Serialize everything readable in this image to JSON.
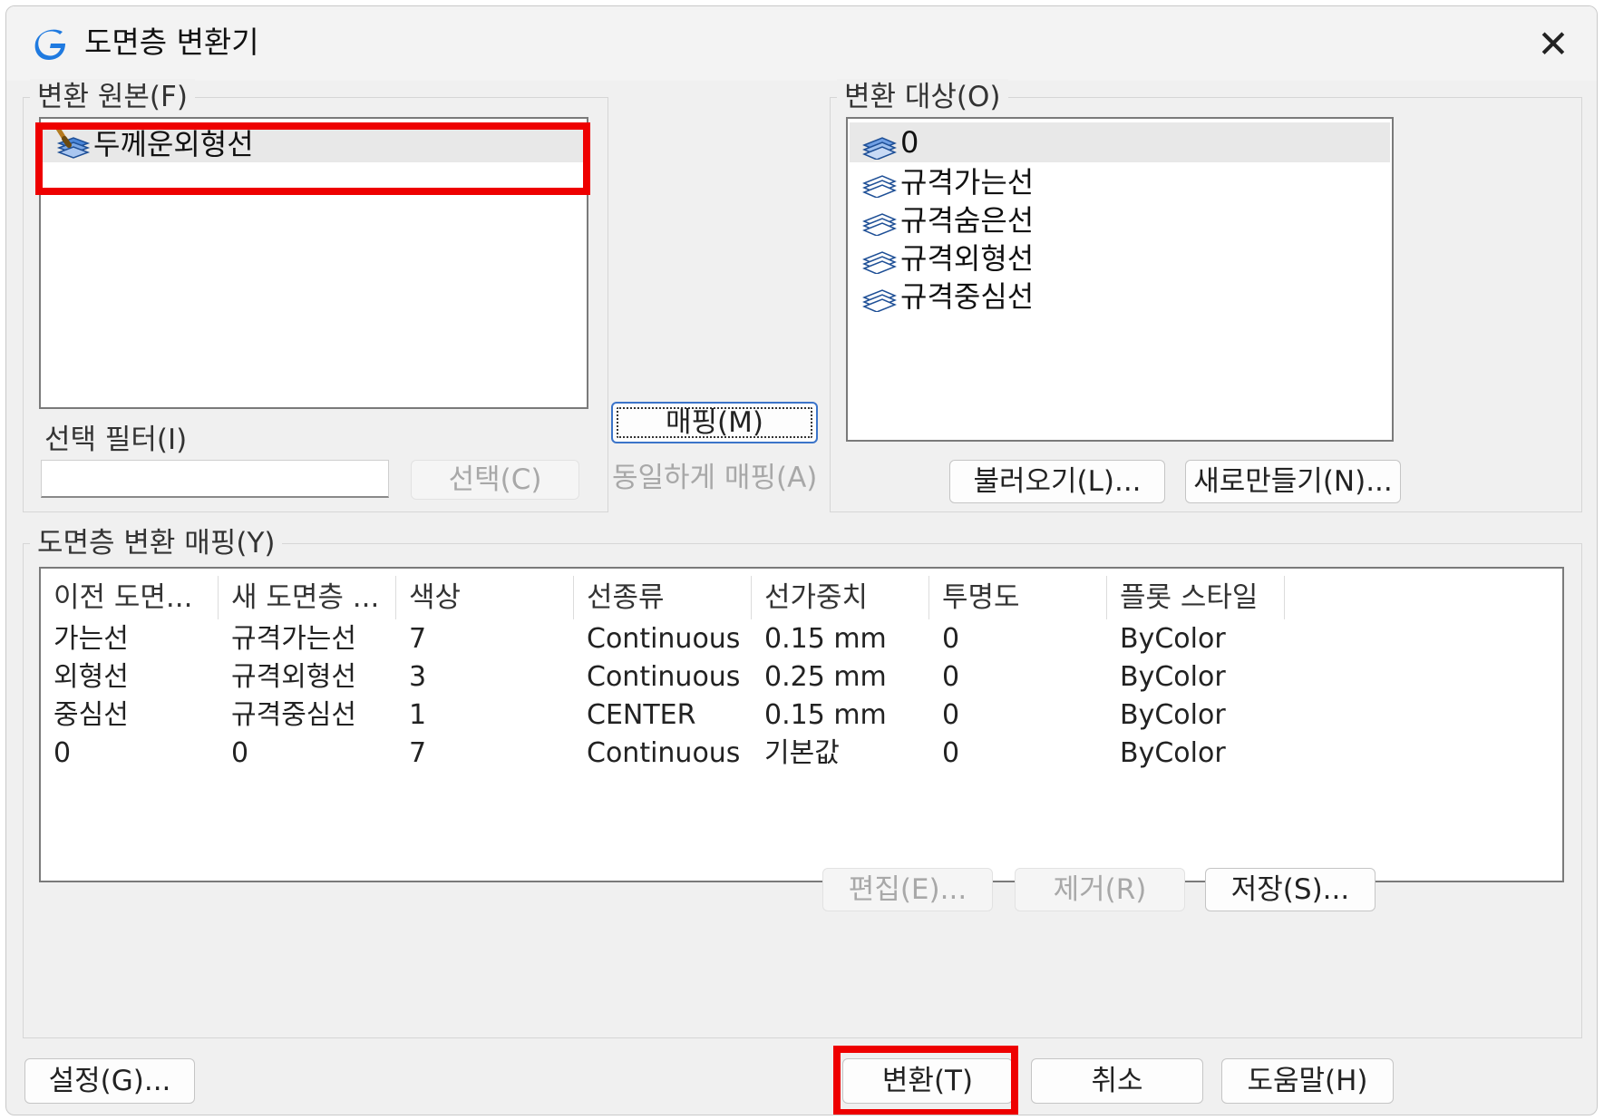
{
  "window": {
    "title": "도면층 변환기",
    "close_label": "✕"
  },
  "source": {
    "group_label": "변환 원본(F)",
    "items": [
      {
        "label": "두께운외형선"
      }
    ],
    "filter_label": "선택 필터(I)",
    "filter_value": "",
    "select_button": "선택(C)"
  },
  "middle": {
    "map_button": "매핑(M)",
    "map_same_button": "동일하게 매핑(A)"
  },
  "target": {
    "group_label": "변환 대상(O)",
    "items": [
      {
        "label": "0"
      },
      {
        "label": "규격가는선"
      },
      {
        "label": "규격숨은선"
      },
      {
        "label": "규격외형선"
      },
      {
        "label": "규격중심선"
      }
    ],
    "load_button": "불러오기(L)...",
    "new_button": "새로만들기(N)..."
  },
  "mapping": {
    "group_label": "도면층 변환 매핑(Y)",
    "columns": [
      "이전 도면...",
      "새 도면층 ...",
      "색상",
      "선종류",
      "선가중치",
      "투명도",
      "플롯 스타일"
    ],
    "rows": [
      [
        "가는선",
        "규격가는선",
        "7",
        "Continuous",
        "0.15 mm",
        "0",
        "ByColor"
      ],
      [
        "외형선",
        "규격외형선",
        "3",
        "Continuous",
        "0.25 mm",
        "0",
        "ByColor"
      ],
      [
        "중심선",
        "규격중심선",
        "1",
        "CENTER",
        "0.15 mm",
        "0",
        "ByColor"
      ],
      [
        "0",
        "0",
        "7",
        "Continuous",
        "기본값",
        "0",
        "ByColor"
      ]
    ],
    "edit_button": "편집(E)...",
    "remove_button": "제거(R)",
    "save_button": "저장(S)..."
  },
  "footer": {
    "settings_button": "설정(G)...",
    "convert_button": "변환(T)",
    "cancel_button": "취소",
    "help_button": "도움말(H)"
  },
  "colors": {
    "highlight": "#ee0000",
    "focus": "#3b74c9",
    "layer_icon": "#2f6fc8"
  }
}
